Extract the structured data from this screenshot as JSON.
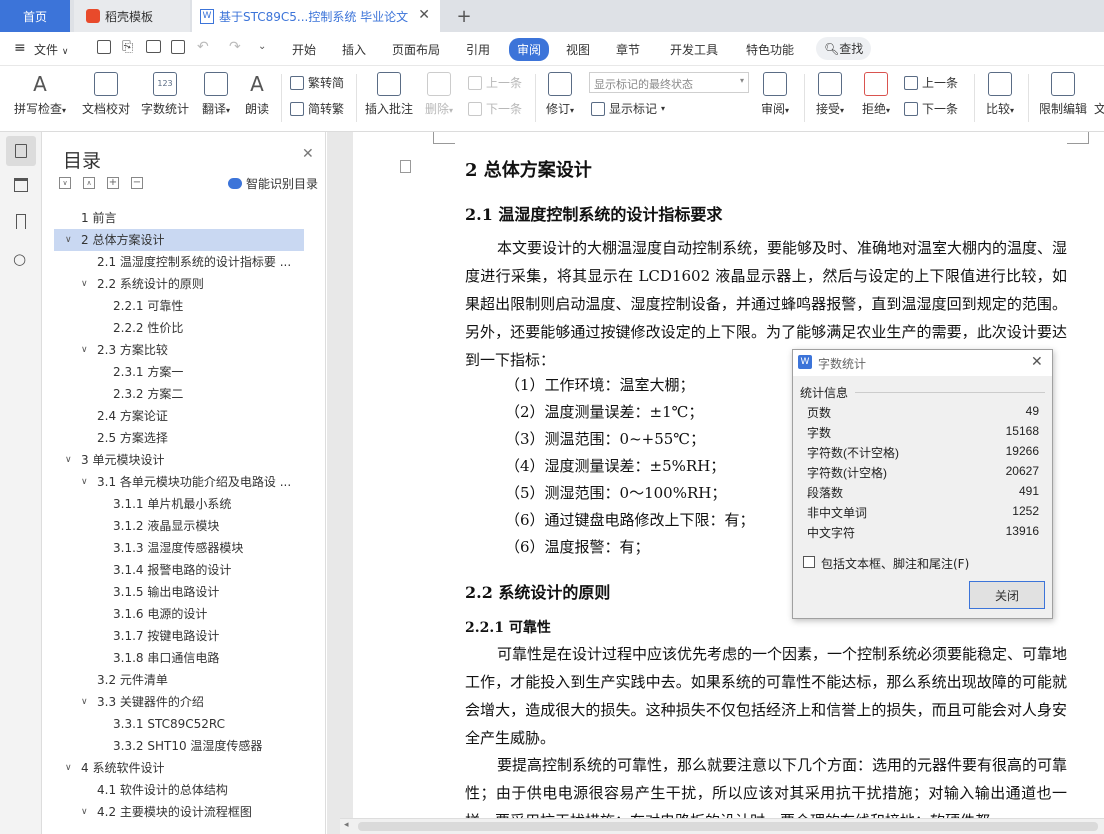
{
  "tabs": {
    "home": "首页",
    "daoke": "稻壳模板",
    "doc": "基于STC89C5...控制系统 毕业论文",
    "new_tab": "+"
  },
  "menu": {
    "file": "文件",
    "items": [
      "开始",
      "插入",
      "页面布局",
      "引用",
      "审阅",
      "视图",
      "章节",
      "开发工具",
      "特色功能"
    ],
    "search": "查找"
  },
  "toolbar": {
    "spell": "拼写检查",
    "proof": "文档校对",
    "count": "字数统计",
    "translate": "翻译",
    "read": "朗读",
    "trad": "繁转简",
    "simp": "简转繁",
    "insert_comment": "插入批注",
    "delete": "删除",
    "prev": "上一条",
    "next": "下一条",
    "revise": "修订",
    "markup_select": "显示标记的最终状态",
    "show_markup": "显示标记",
    "review": "审阅",
    "accept": "接受",
    "reject": "拒绝",
    "prev2": "上一条",
    "next2": "下一条",
    "compare": "比较",
    "restrict": "限制编辑",
    "doc_cut": "文"
  },
  "nav": {
    "title": "目录",
    "smart": "智能识别目录",
    "items": [
      {
        "label": "1  前言",
        "level": 1
      },
      {
        "label": "2  总体方案设计",
        "level": 1,
        "expanded": true,
        "selected": true
      },
      {
        "label": "2.1  温湿度控制系统的设计指标要 ...",
        "level": 2
      },
      {
        "label": "2.2  系统设计的原则",
        "level": 2,
        "expanded": true
      },
      {
        "label": "2.2.1  可靠性",
        "level": 3
      },
      {
        "label": "2.2.2  性价比",
        "level": 3
      },
      {
        "label": "2.3  方案比较",
        "level": 2,
        "expanded": true
      },
      {
        "label": "2.3.1  方案一",
        "level": 3
      },
      {
        "label": "2.3.2  方案二",
        "level": 3
      },
      {
        "label": "2.4  方案论证",
        "level": 2
      },
      {
        "label": "2.5  方案选择",
        "level": 2
      },
      {
        "label": "3  单元模块设计",
        "level": 1,
        "expanded": true
      },
      {
        "label": "3.1  各单元模块功能介绍及电路设 ...",
        "level": 2,
        "expanded": true
      },
      {
        "label": "3.1.1  单片机最小系统",
        "level": 3
      },
      {
        "label": "3.1.2  液晶显示模块",
        "level": 3
      },
      {
        "label": "3.1.3  温湿度传感器模块",
        "level": 3
      },
      {
        "label": "3.1.4   报警电路的设计",
        "level": 3
      },
      {
        "label": "3.1.5  输出电路设计",
        "level": 3
      },
      {
        "label": "3.1.6  电源的设计",
        "level": 3
      },
      {
        "label": "3.1.7   按键电路设计",
        "level": 3
      },
      {
        "label": "3.1.8  串口通信电路",
        "level": 3
      },
      {
        "label": "3.2  元件清单",
        "level": 2
      },
      {
        "label": "3.3  关键器件的介绍",
        "level": 2,
        "expanded": true
      },
      {
        "label": "3.3.1 STC89C52RC",
        "level": 3
      },
      {
        "label": "3.3.2 SHT10 温湿度传感器",
        "level": 3
      },
      {
        "label": "4  系统软件设计",
        "level": 1,
        "expanded": true
      },
      {
        "label": "4.1  软件设计的总体结构",
        "level": 2
      },
      {
        "label": "4.2  主要模块的设计流程框图",
        "level": 2,
        "expanded": true
      }
    ]
  },
  "doc": {
    "h1": "2  总体方案设计",
    "h2a": "2.1  温湿度控制系统的设计指标要求",
    "p1": "本文要设计的大棚温湿度自动控制系统，要能够及时、准确地对温室大棚内的温度、湿度进行采集，将其显示在 LCD1602 液晶显示器上，然后与设定的上下限值进行比较，如果超出限制则启动温度、湿度控制设备，并通过蜂鸣器报警，直到温湿度回到规定的范围。另外，还要能够通过按键修改设定的上下限。为了能够满足农业生产的需要，此次设计要达到一下指标：",
    "list": [
      "（1）工作环境：温室大棚；",
      "（2）温度测量误差：±1℃；",
      "（3）测温范围：0~+55℃；",
      "（4）湿度测量误差：±5%RH；",
      "（5）测湿范围：0～100%RH；",
      "（6）通过键盘电路修改上下限：有；",
      "（6）温度报警：有；"
    ],
    "h2b": "2.2  系统设计的原则",
    "h3": "2.2.1  可靠性",
    "p2": "可靠性是在设计过程中应该优先考虑的一个因素，一个控制系统必须要能稳定、可靠地工作，才能投入到生产实践中去。如果系统的可靠性不能达标，那么系统出现故障的可能就会增大，造成很大的损失。这种损失不仅包括经济上和信誉上的损失，而且可能会对人身安全产生威胁。",
    "p3": "要提高控制系统的可靠性，那么就要注意以下几个方面：选用的元器件要有很高的可靠性；由于供电电源很容易产生干扰，所以应该对其采用抗干扰措施；对输入输出通道也一样，要采用抗干扰措施；在对电路板的设计时，要合理的布线和接地；软硬件都"
  },
  "dialog": {
    "title": "字数统计",
    "group": "统计信息",
    "rows": [
      {
        "label": "页数",
        "value": "49"
      },
      {
        "label": "字数",
        "value": "15168"
      },
      {
        "label": "字符数(不计空格)",
        "value": "19266"
      },
      {
        "label": "字符数(计空格)",
        "value": "20627"
      },
      {
        "label": "段落数",
        "value": "491"
      },
      {
        "label": "非中文单词",
        "value": "1252"
      },
      {
        "label": "中文字符",
        "value": "13916"
      }
    ],
    "checkbox": "包括文本框、脚注和尾注(F)",
    "close": "关闭"
  },
  "colors": {
    "accent": "#3c74d9",
    "selected": "#c9d8f2"
  }
}
